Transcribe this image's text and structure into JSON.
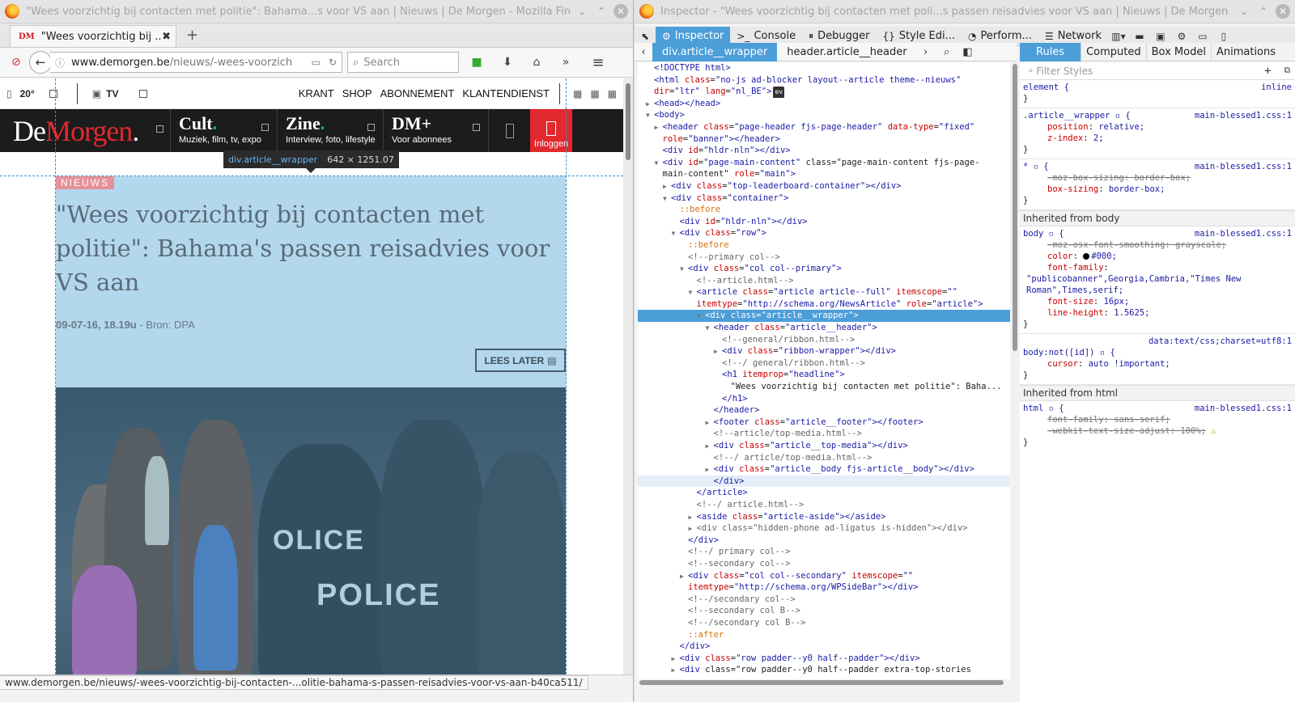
{
  "browser": {
    "title": "\"Wees voorzichtig bij contacten met politie\": Bahama...s voor VS aan | Nieuws | De Morgen - Mozilla Firefox",
    "tab_title": "\"Wees voorzichtig bij ...",
    "url_host": "www.demorgen.be",
    "url_path": "/nieuws/-wees-voorzich",
    "search_placeholder": "Search",
    "status_url": "www.demorgen.be/nieuws/-wees-voorzichtig-bij-contacten-...olitie-bahama-s-passen-reisadvies-voor-vs-aan-b40ca511/"
  },
  "site": {
    "weather": "20°",
    "tv_label": "TV",
    "topnav": [
      "KRANT",
      "SHOP",
      "ABONNEMENT",
      "KLANTENDIENST"
    ],
    "logo_part1": "De",
    "logo_part2": "Morgen",
    "logo_dot": ".",
    "brands": [
      {
        "title": "Cult",
        "sub": "Muziek, film, tv, expo"
      },
      {
        "title": "Zine",
        "sub": "Interview, foto, lifestyle"
      },
      {
        "title": "DM+",
        "sub": "Voor abonnees"
      }
    ],
    "login_label": "Inloggen"
  },
  "article": {
    "section": "NIEUWS",
    "headline": "\"Wees voorzichtig bij contacten met politie\": Bahama's passen reisadvies voor VS aan",
    "date": "09-07-16, 18.19u",
    "source": " - Bron: DPA",
    "read_later": "LEES LATER",
    "photo_text_1": "OLICE",
    "photo_text_2": "POLICE"
  },
  "highlighter": {
    "selector": "div.article__wrapper",
    "dimensions": "642 × 1251.07"
  },
  "devtools": {
    "title": "Inspector - \"Wees voorzichtig bij contacten met poli...s passen reisadvies voor VS aan | Nieuws | De Morgen",
    "tabs": [
      "Inspector",
      "Console",
      "Debugger",
      "Style Edi...",
      "Perform...",
      "Network"
    ],
    "crumbs": [
      "div.article__wrapper",
      "header.article__header"
    ],
    "side_tabs": [
      "Rules",
      "Computed",
      "Box Model",
      "Animations"
    ],
    "filter_placeholder": "Filter Styles"
  },
  "markup": [
    {
      "indent": 0,
      "tw": "",
      "type": "plain",
      "text": "<!DOCTYPE html>"
    },
    {
      "indent": 0,
      "tw": "",
      "type": "html",
      "text": "<html class=\"no-js ad-blocker layout--article theme--nieuws\""
    },
    {
      "indent": 0,
      "tw": "",
      "type": "html2",
      "text": "dir=\"ltr\" lang=\"nl_BE\">"
    },
    {
      "indent": 0,
      "tw": "▶",
      "type": "tag",
      "text": "<head></head>"
    },
    {
      "indent": 0,
      "tw": "▼",
      "type": "tag",
      "text": "<body>"
    },
    {
      "indent": 1,
      "tw": "▶",
      "type": "tag",
      "text": "<header class=\"page-header fjs-page-header\" data-type=\"fixed\""
    },
    {
      "indent": 1,
      "tw": "",
      "type": "tag",
      "text": "role=\"banner\"></header>"
    },
    {
      "indent": 1,
      "tw": "",
      "type": "tag",
      "text": "<div id=\"hldr-nln\"></div>"
    },
    {
      "indent": 1,
      "tw": "▼",
      "type": "tag",
      "text": "<div id=\"page-main-content\" class=\"page-main-content fjs-page-"
    },
    {
      "indent": 1,
      "tw": "",
      "type": "tag",
      "text": "main-content\" role=\"main\">"
    },
    {
      "indent": 2,
      "tw": "▶",
      "type": "tag",
      "text": "<div class=\"top-leaderboard-container\"></div>"
    },
    {
      "indent": 2,
      "tw": "▼",
      "type": "tag",
      "text": "<div class=\"container\">"
    },
    {
      "indent": 3,
      "tw": "",
      "type": "pseudo",
      "text": "::before"
    },
    {
      "indent": 3,
      "tw": "",
      "type": "tag",
      "text": "<div id=\"hldr-nln\"></div>"
    },
    {
      "indent": 3,
      "tw": "▼",
      "type": "tag",
      "text": "<div class=\"row\">"
    },
    {
      "indent": 4,
      "tw": "",
      "type": "pseudo",
      "text": "::before"
    },
    {
      "indent": 4,
      "tw": "",
      "type": "cmt",
      "text": "<!--primary col-->"
    },
    {
      "indent": 4,
      "tw": "▼",
      "type": "tag",
      "text": "<div class=\"col col--primary\">"
    },
    {
      "indent": 5,
      "tw": "",
      "type": "cmt",
      "text": "<!--article.html-->"
    },
    {
      "indent": 5,
      "tw": "▼",
      "type": "tag",
      "text": "<article class=\"article article--full\" itemscope=\"\""
    },
    {
      "indent": 5,
      "tw": "",
      "type": "tag",
      "text": "itemtype=\"http://schema.org/NewsArticle\" role=\"article\">"
    },
    {
      "indent": 6,
      "tw": "▼",
      "type": "sel",
      "text": "<div class=\"article__wrapper\">"
    },
    {
      "indent": 7,
      "tw": "▼",
      "type": "tag",
      "text": "<header class=\"article__header\">"
    },
    {
      "indent": 8,
      "tw": "",
      "type": "cmt",
      "text": "<!--general/ribbon.html-->"
    },
    {
      "indent": 8,
      "tw": "▶",
      "type": "tag",
      "text": "<div class=\"ribbon-wrapper\"></div>"
    },
    {
      "indent": 8,
      "tw": "",
      "type": "cmt",
      "text": "<!--/ general/ribbon.html-->"
    },
    {
      "indent": 8,
      "tw": "",
      "type": "tag",
      "text": "<h1 itemprop=\"headline\">"
    },
    {
      "indent": 9,
      "tw": "",
      "type": "txt",
      "text": "\"Wees voorzichtig bij contacten met politie\": Baha..."
    },
    {
      "indent": 8,
      "tw": "",
      "type": "tag",
      "text": "</h1>"
    },
    {
      "indent": 7,
      "tw": "",
      "type": "tag",
      "text": "</header>"
    },
    {
      "indent": 7,
      "tw": "▶",
      "type": "tag",
      "text": "<footer class=\"article__footer\"></footer>"
    },
    {
      "indent": 7,
      "tw": "",
      "type": "cmt",
      "text": "<!--article/top-media.html-->"
    },
    {
      "indent": 7,
      "tw": "▶",
      "type": "tag",
      "text": "<div class=\"article__top-media\"></div>"
    },
    {
      "indent": 7,
      "tw": "",
      "type": "cmt",
      "text": "<!--/ article/top-media.html-->"
    },
    {
      "indent": 7,
      "tw": "▶",
      "type": "tag",
      "text": "<div class=\"article__body fjs-article__body\"></div>"
    },
    {
      "indent": 7,
      "tw": "",
      "type": "hover",
      "text": "</div>"
    },
    {
      "indent": 5,
      "tw": "",
      "type": "tag",
      "text": "</article>"
    },
    {
      "indent": 5,
      "tw": "",
      "type": "cmt",
      "text": "<!--/ article.html-->"
    },
    {
      "indent": 5,
      "tw": "▶",
      "type": "tag",
      "text": "<aside class=\"article-aside\"></aside>"
    },
    {
      "indent": 5,
      "tw": "▶",
      "type": "cmtag",
      "text": "<div class=\"hidden-phone ad-ligatus is-hidden\"></div>"
    },
    {
      "indent": 4,
      "tw": "",
      "type": "tag",
      "text": "</div>"
    },
    {
      "indent": 4,
      "tw": "",
      "type": "cmt",
      "text": "<!--/ primary col-->"
    },
    {
      "indent": 4,
      "tw": "",
      "type": "cmt",
      "text": "<!--secondary col-->"
    },
    {
      "indent": 4,
      "tw": "▶",
      "type": "tag",
      "text": "<div class=\"col col--secondary\" itemscope=\"\""
    },
    {
      "indent": 4,
      "tw": "",
      "type": "tag",
      "text": "itemtype=\"http://schema.org/WPSideBar\"></div>"
    },
    {
      "indent": 4,
      "tw": "",
      "type": "cmt",
      "text": "<!--/secondary col-->"
    },
    {
      "indent": 4,
      "tw": "",
      "type": "cmt",
      "text": "<!--secondary col B-->"
    },
    {
      "indent": 4,
      "tw": "",
      "type": "cmt",
      "text": "<!--/secondary col B-->"
    },
    {
      "indent": 4,
      "tw": "",
      "type": "pseudo",
      "text": "::after"
    },
    {
      "indent": 3,
      "tw": "",
      "type": "tag",
      "text": "</div>"
    },
    {
      "indent": 3,
      "tw": "▶",
      "type": "tag",
      "text": "<div class=\"row padder--y0 half--padder\"></div>"
    },
    {
      "indent": 3,
      "tw": "▶",
      "type": "tag",
      "text": "<div class=\"row padder--y0 half--padder extra-top-stories"
    }
  ],
  "rules": {
    "element_selector": "element {",
    "element_src": "inline",
    "r1_selector": ".article__wrapper",
    "r1_src": "main-blessed1.css:1",
    "r1_decl": [
      [
        "position",
        "relative;"
      ],
      [
        "z-index",
        "2;"
      ]
    ],
    "r2_selector": "*",
    "r2_src": "main-blessed1.css:1",
    "r2_off": "-moz-box-sizing: border-box;",
    "r2_decl": [
      "box-sizing",
      "border-box;"
    ],
    "inh_body": "Inherited from body",
    "r3_selector": "body",
    "r3_src": "main-blessed1.css:1",
    "r3_off": "-moz-osx-font-smoothing: grayscale;",
    "r3_color": [
      "color",
      "#000;"
    ],
    "r3_ff_prop": "font-family",
    "r3_ff_val": "\"publicobanner\",Georgia,Cambria,\"Times New Roman\",Times,serif;",
    "r3_fs": [
      "font-size",
      "16px;"
    ],
    "r3_lh": [
      "line-height",
      "1.5625;"
    ],
    "r4_src": "data:text/css;charset=utf8:1",
    "r4_selector": "body:not([id])",
    "r4_decl": [
      "cursor",
      "auto !important;"
    ],
    "inh_html": "Inherited from html",
    "r5_selector": "html",
    "r5_src": "main-blessed1.css:1",
    "r5_off1": "font-family: sans-serif;",
    "r5_off2": "-webkit-text-size-adjust: 100%;"
  }
}
